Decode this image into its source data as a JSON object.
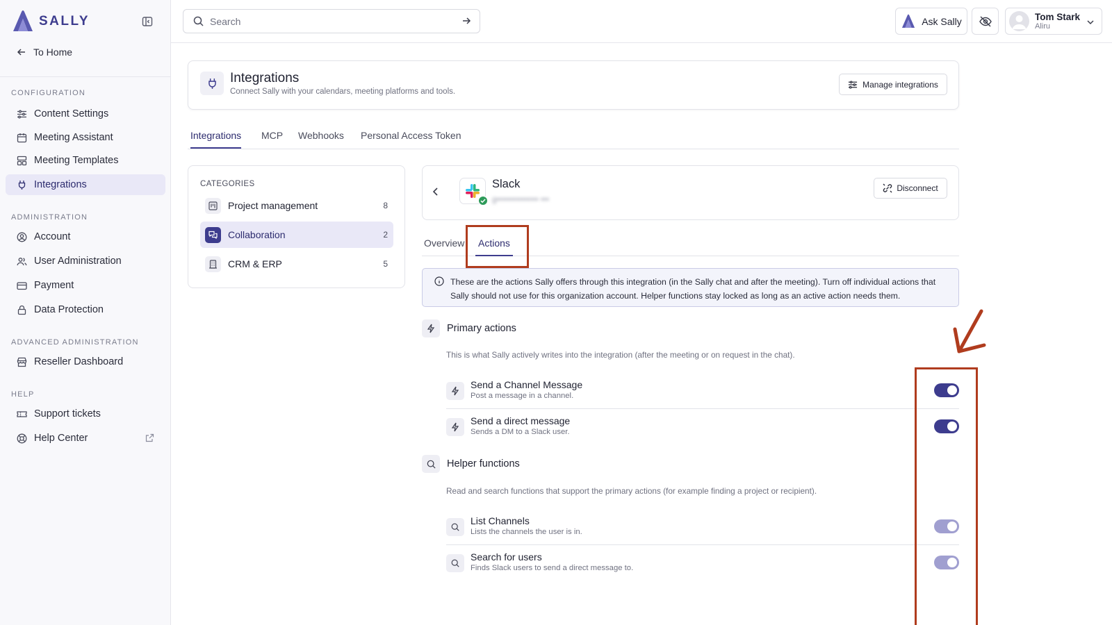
{
  "app": {
    "logo_text": "SALLY"
  },
  "sidebar": {
    "to_home": "To Home",
    "sections": [
      {
        "title": "CONFIGURATION",
        "items": [
          {
            "label": "Content Settings",
            "icon": "sliders-icon"
          },
          {
            "label": "Meeting Assistant",
            "icon": "calendar-icon"
          },
          {
            "label": "Meeting Templates",
            "icon": "template-icon"
          },
          {
            "label": "Integrations",
            "icon": "plug-icon",
            "active": true
          }
        ]
      },
      {
        "title": "ADMINISTRATION",
        "items": [
          {
            "label": "Account",
            "icon": "user-circle-icon"
          },
          {
            "label": "User Administration",
            "icon": "users-icon"
          },
          {
            "label": "Payment",
            "icon": "credit-card-icon"
          },
          {
            "label": "Data Protection",
            "icon": "lock-icon"
          }
        ]
      },
      {
        "title": "ADVANCED ADMINISTRATION",
        "items": [
          {
            "label": "Reseller Dashboard",
            "icon": "store-icon"
          }
        ]
      },
      {
        "title": "HELP",
        "items": [
          {
            "label": "Support tickets",
            "icon": "ticket-icon"
          },
          {
            "label": "Help Center",
            "icon": "lifebuoy-icon",
            "external": true
          }
        ]
      }
    ]
  },
  "topbar": {
    "search_placeholder": "Search",
    "ask_label": "Ask Sally",
    "user": {
      "name": "Tom Stark",
      "org": "Aliru"
    }
  },
  "header": {
    "title": "Integrations",
    "subtitle": "Connect Sally with your calendars, meeting platforms and tools.",
    "manage_label": "Manage integrations"
  },
  "main_tabs": [
    {
      "label": "Integrations",
      "active": true
    },
    {
      "label": "MCP"
    },
    {
      "label": "Webhooks"
    },
    {
      "label": "Personal Access Token"
    }
  ],
  "categories": {
    "title": "CATEGORIES",
    "items": [
      {
        "label": "Project management",
        "count": "8",
        "icon": "kanban-icon"
      },
      {
        "label": "Collaboration",
        "count": "2",
        "icon": "chat-icon",
        "active": true
      },
      {
        "label": "CRM & ERP",
        "count": "5",
        "icon": "building-icon"
      }
    ]
  },
  "integration": {
    "name": "Slack",
    "account": "g••••••••••••••• •••",
    "connected": true,
    "disconnect_label": "Disconnect",
    "tabs": [
      {
        "label": "Overview"
      },
      {
        "label": "Actions",
        "active": true
      }
    ],
    "info_text": "These are the actions Sally offers through this integration (in the Sally chat and after the meeting). Turn off individual actions that Sally should not use for this organization account. Helper functions stay locked as long as an active action needs them.",
    "primary": {
      "title": "Primary actions",
      "description": "This is what Sally actively writes into the integration (after the meeting or on request in the chat).",
      "actions": [
        {
          "title": "Send a Channel Message",
          "description": "Post a message in a channel.",
          "enabled": true
        },
        {
          "title": "Send a direct message",
          "description": "Sends a DM to a Slack user.",
          "enabled": true
        }
      ]
    },
    "helpers": {
      "title": "Helper functions",
      "description": "Read and search functions that support the primary actions (for example finding a project or recipient).",
      "actions": [
        {
          "title": "List Channels",
          "description": "Lists the channels the user is in.",
          "enabled": true,
          "locked": true
        },
        {
          "title": "Search for users",
          "description": "Finds Slack users to send a direct message to.",
          "enabled": true,
          "locked": true
        }
      ]
    }
  },
  "colors": {
    "accent": "#3d3c8e",
    "accent_light": "#e9e8f7",
    "annotation": "#b03c1e",
    "locked_toggle": "#a09fd0"
  }
}
